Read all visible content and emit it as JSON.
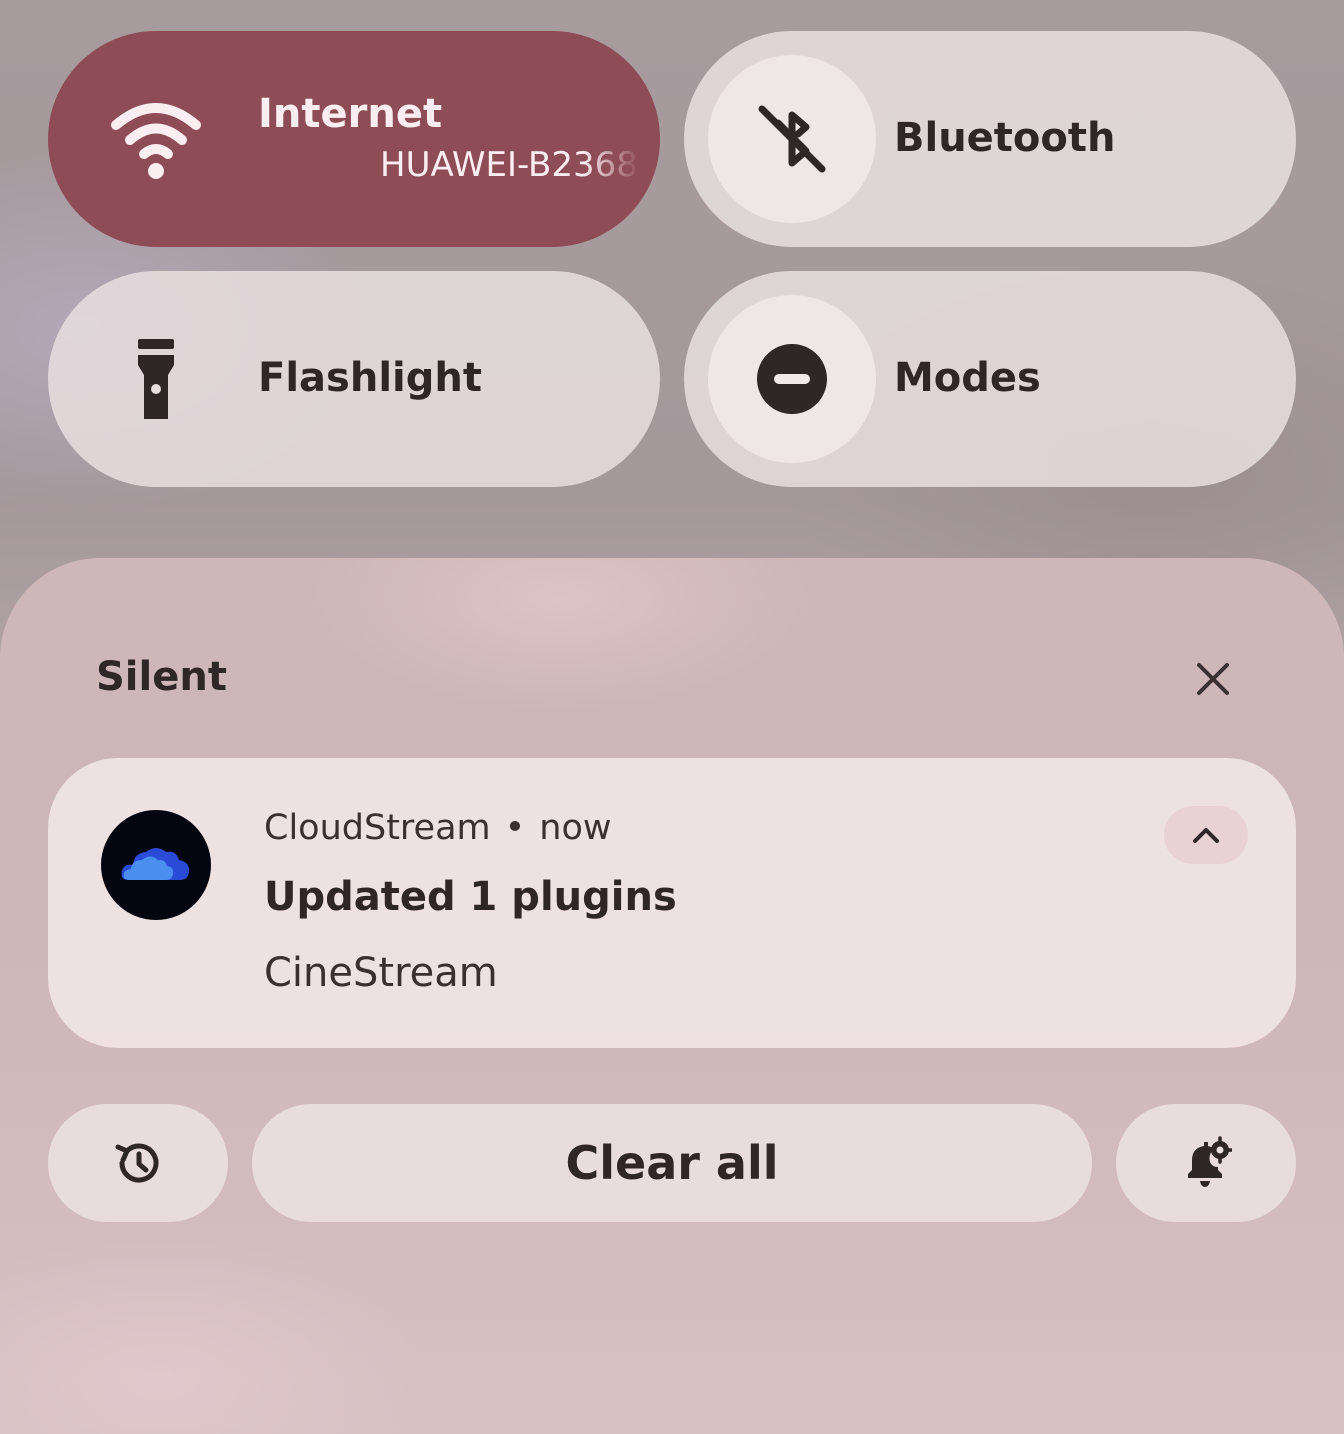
{
  "quick_settings": {
    "internet": {
      "label": "Internet",
      "network": "HUAWEI-B2368",
      "state": "on",
      "icon": "wifi-icon"
    },
    "bluetooth": {
      "label": "Bluetooth",
      "state": "off",
      "icon": "bluetooth-off-icon"
    },
    "flashlight": {
      "label": "Flashlight",
      "state": "off",
      "icon": "flashlight-icon"
    },
    "modes": {
      "label": "Modes",
      "state": "off",
      "icon": "do-not-disturb-icon"
    }
  },
  "notifications": {
    "section_title": "Silent",
    "close_icon": "close-icon",
    "items": [
      {
        "app": "CloudStream",
        "separator": "•",
        "time": "now",
        "title": "Updated 1 plugins",
        "body": "CineStream",
        "app_icon": "cloudstream-cloud-icon",
        "expand_icon": "chevron-up-icon"
      }
    ]
  },
  "actions": {
    "history_icon": "history-icon",
    "clear_all_label": "Clear all",
    "settings_icon": "notification-settings-icon"
  },
  "colors": {
    "active_tile": "#8e4c56",
    "inactive_tile": "#e8dee0",
    "text_dark": "#2f2628",
    "text_light": "#fbeef0"
  }
}
